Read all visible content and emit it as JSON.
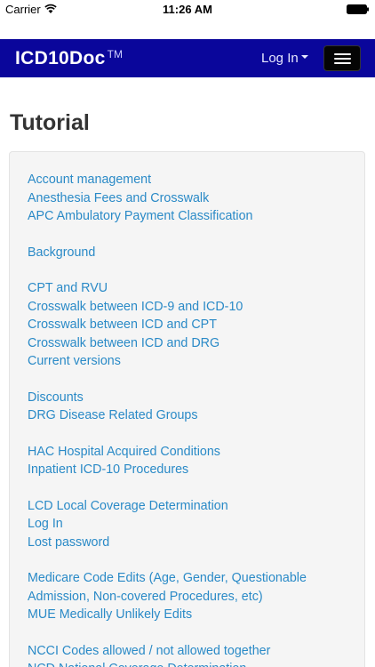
{
  "status_bar": {
    "carrier": "Carrier",
    "time": "11:26 AM",
    "wifi_icon": "wifi-icon",
    "battery_icon": "battery-icon"
  },
  "navbar": {
    "brand_main": "ICD10Doc",
    "brand_tm": "TM",
    "login_label": "Log In",
    "background_color": "#0a069b",
    "menu_icon": "hamburger-icon"
  },
  "page": {
    "title": "Tutorial"
  },
  "tutorial_groups": [
    {
      "items": [
        "Account management",
        "Anesthesia Fees and Crosswalk",
        "APC Ambulatory Payment Classification"
      ]
    },
    {
      "items": [
        "Background"
      ]
    },
    {
      "items": [
        "CPT and RVU",
        "Crosswalk between ICD-9 and ICD-10",
        "Crosswalk between ICD and CPT",
        "Crosswalk between ICD and DRG",
        "Current versions"
      ]
    },
    {
      "items": [
        "Discounts",
        "DRG Disease Related Groups"
      ]
    },
    {
      "items": [
        "HAC Hospital Acquired Conditions",
        "Inpatient ICD-10 Procedures"
      ]
    },
    {
      "items": [
        "LCD Local Coverage Determination",
        "Log In",
        "Lost password"
      ]
    },
    {
      "items": [
        "Medicare Code Edits (Age, Gender, Questionable Admission, Non-covered Procedures, etc)",
        "MUE Medically Unlikely Edits"
      ]
    },
    {
      "items": [
        "NCCI Codes allowed / not allowed together",
        "NCD National Coverage Determination"
      ]
    }
  ],
  "colors": {
    "link": "#2a8ac7",
    "well_background": "#f5f5f5"
  }
}
